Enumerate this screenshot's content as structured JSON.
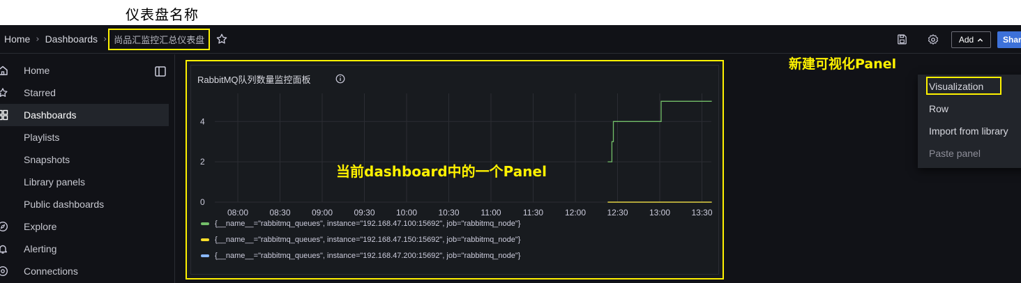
{
  "annotations": {
    "top": "仪表盘名称",
    "panel": "当前dashboard中的一个Panel",
    "menu": "新建可视化Panel"
  },
  "breadcrumb": {
    "home": "Home",
    "dashboards": "Dashboards",
    "current": "尚品汇监控汇总仪表盘"
  },
  "toolbar": {
    "add_label": "Add",
    "share_label": "Shar"
  },
  "sidebar": {
    "items": [
      {
        "label": "Home",
        "icon": "home-icon"
      },
      {
        "label": "Starred",
        "icon": "star-icon"
      },
      {
        "label": "Dashboards",
        "icon": "grid-icon",
        "active": true
      },
      {
        "label": "Playlists"
      },
      {
        "label": "Snapshots"
      },
      {
        "label": "Library panels"
      },
      {
        "label": "Public dashboards"
      },
      {
        "label": "Explore",
        "icon": "compass-icon"
      },
      {
        "label": "Alerting",
        "icon": "bell-icon"
      },
      {
        "label": "Connections",
        "icon": "connections-icon"
      }
    ]
  },
  "add_menu": {
    "items": [
      {
        "label": "Visualization"
      },
      {
        "label": "Row"
      },
      {
        "label": "Import from library"
      },
      {
        "label": "Paste panel",
        "disabled": true
      }
    ]
  },
  "panel": {
    "title": "RabbitMQ队列数量监控面板"
  },
  "chart_data": {
    "type": "line",
    "x_ticks": [
      "08:00",
      "08:30",
      "09:00",
      "09:30",
      "10:00",
      "10:30",
      "11:00",
      "11:30",
      "12:00",
      "12:30",
      "13:00",
      "13:30"
    ],
    "y_ticks": [
      "0",
      "2",
      "4"
    ],
    "ylim": [
      0,
      5.5
    ],
    "grid": true,
    "legend_position": "bottom",
    "series": [
      {
        "name": "{__name__=\"rabbitmq_queues\", instance=\"192.168.47.100:15692\", job=\"rabbitmq_node\"}",
        "color": "#73bf69",
        "points": [
          [
            "12:23",
            2
          ],
          [
            "12:26",
            2
          ],
          [
            "12:26",
            3
          ],
          [
            "12:27",
            3
          ],
          [
            "12:27",
            4
          ],
          [
            "13:01",
            4
          ],
          [
            "13:01",
            5
          ],
          [
            "13:37",
            5
          ]
        ]
      },
      {
        "name": "{__name__=\"rabbitmq_queues\", instance=\"192.168.47.150:15692\", job=\"rabbitmq_node\"}",
        "color": "#fade2a",
        "points": [
          [
            "12:23",
            0
          ],
          [
            "13:37",
            0
          ]
        ]
      },
      {
        "name": "{__name__=\"rabbitmq_queues\", instance=\"192.168.47.200:15692\", job=\"rabbitmq_node\"}",
        "color": "#8ab8ff",
        "points": [
          [
            "12:23",
            0
          ],
          [
            "13:37",
            0
          ]
        ]
      }
    ]
  }
}
